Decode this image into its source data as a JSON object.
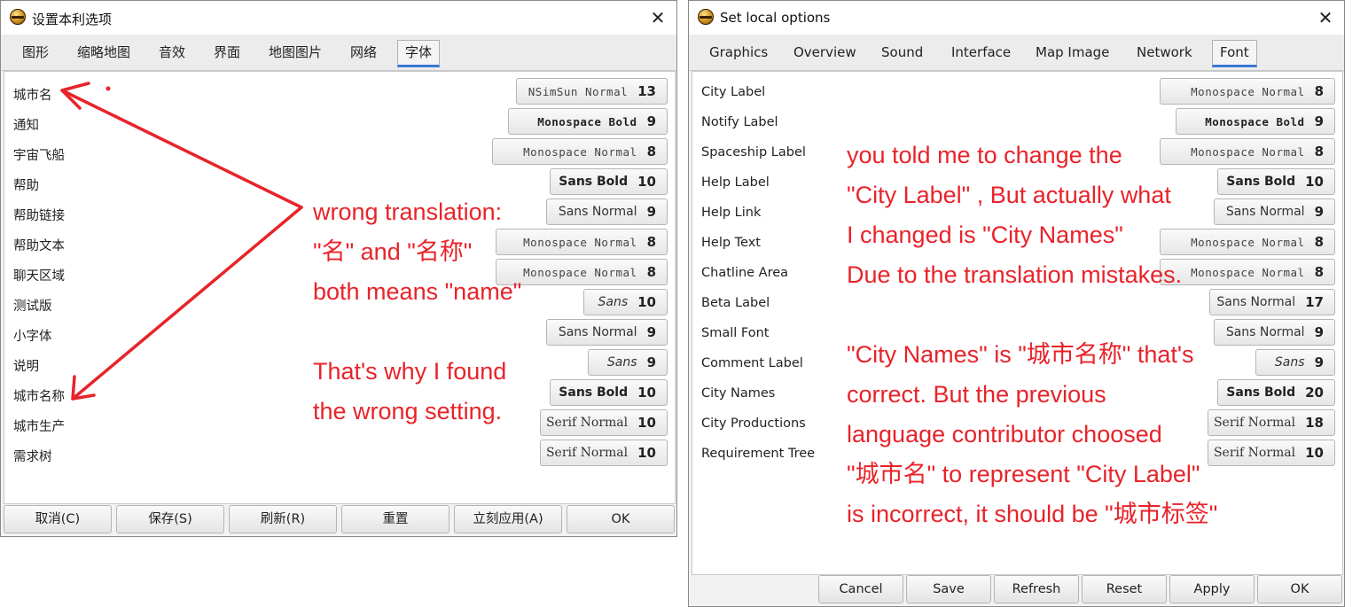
{
  "left_window": {
    "title": "设置本利选项",
    "tabs": [
      "图形",
      "缩略地图",
      "音效",
      "界面",
      "地图图片",
      "网络",
      "字体"
    ],
    "active_tab": "字体",
    "rows": [
      {
        "label": "城市名",
        "font": "NSimSun Normal",
        "size": "13",
        "style": "mono"
      },
      {
        "label": "通知",
        "font": "Monospace Bold",
        "size": "9",
        "style": "mono-bold"
      },
      {
        "label": "宇宙飞船",
        "font": "Monospace Normal",
        "size": "8",
        "style": "mono"
      },
      {
        "label": "帮助",
        "font": "Sans Bold",
        "size": "10",
        "style": "sans-bold"
      },
      {
        "label": "帮助链接",
        "font": "Sans Normal",
        "size": "9",
        "style": "sans"
      },
      {
        "label": "帮助文本",
        "font": "Monospace Normal",
        "size": "8",
        "style": "mono"
      },
      {
        "label": "聊天区域",
        "font": "Monospace Normal",
        "size": "8",
        "style": "mono"
      },
      {
        "label": "测试版",
        "font": "Sans",
        "size": "10",
        "style": "sans-italic"
      },
      {
        "label": "小字体",
        "font": "Sans Normal",
        "size": "9",
        "style": "sans"
      },
      {
        "label": "说明",
        "font": "Sans",
        "size": "9",
        "style": "sans-italic"
      },
      {
        "label": "城市名称",
        "font": "Sans Bold",
        "size": "10",
        "style": "sans-bold"
      },
      {
        "label": "城市生产",
        "font": "Serif Normal",
        "size": "10",
        "style": "serif"
      },
      {
        "label": "需求树",
        "font": "Serif Normal",
        "size": "10",
        "style": "serif"
      }
    ],
    "buttons": [
      "取消(C)",
      "保存(S)",
      "刷新(R)",
      "重置",
      "立刻应用(A)",
      "OK"
    ]
  },
  "right_window": {
    "title": "Set local options",
    "tabs": [
      "Graphics",
      "Overview",
      "Sound",
      "Interface",
      "Map Image",
      "Network",
      "Font"
    ],
    "active_tab": "Font",
    "rows": [
      {
        "label": "City Label",
        "font": "Monospace Normal",
        "size": "8",
        "style": "mono"
      },
      {
        "label": "Notify Label",
        "font": "Monospace Bold",
        "size": "9",
        "style": "mono-bold"
      },
      {
        "label": "Spaceship Label",
        "font": "Monospace Normal",
        "size": "8",
        "style": "mono"
      },
      {
        "label": "Help Label",
        "font": "Sans Bold",
        "size": "10",
        "style": "sans-bold"
      },
      {
        "label": "Help Link",
        "font": "Sans Normal",
        "size": "9",
        "style": "sans"
      },
      {
        "label": "Help Text",
        "font": "Monospace Normal",
        "size": "8",
        "style": "mono"
      },
      {
        "label": "Chatline Area",
        "font": "Monospace Normal",
        "size": "8",
        "style": "mono"
      },
      {
        "label": "Beta Label",
        "font": "Sans Normal",
        "size": "17",
        "style": "sans"
      },
      {
        "label": "Small Font",
        "font": "Sans Normal",
        "size": "9",
        "style": "sans"
      },
      {
        "label": "Comment Label",
        "font": "Sans",
        "size": "9",
        "style": "sans-italic"
      },
      {
        "label": "City Names",
        "font": "Sans Bold",
        "size": "20",
        "style": "sans-bold"
      },
      {
        "label": "City Productions",
        "font": "Serif Normal",
        "size": "18",
        "style": "serif"
      },
      {
        "label": "Requirement Tree",
        "font": "Serif Normal",
        "size": "10",
        "style": "serif"
      }
    ],
    "buttons": [
      "Cancel",
      "Save",
      "Refresh",
      "Reset",
      "Apply",
      "OK"
    ]
  },
  "annotations": {
    "left": [
      "wrong translation:",
      "\"名\" and \"名称\"",
      "both means \"name\"",
      "",
      "That's why I found",
      "the wrong setting."
    ],
    "right": [
      "you told me to change the",
      "\"City Label\" , But actually what",
      "I changed is \"City Names\"",
      "Due to the translation mistakes.",
      "",
      "\"City Names\" is \"城市名称\" that's",
      "correct. But the previous",
      "language contributor choosed",
      "\"城市名\" to represent \"City Label\"",
      "is incorrect, it should be \"城市标签\""
    ],
    "color": "#e8232a"
  },
  "icons": {
    "app": "freeciv-globe-icon",
    "close": "close-icon"
  }
}
